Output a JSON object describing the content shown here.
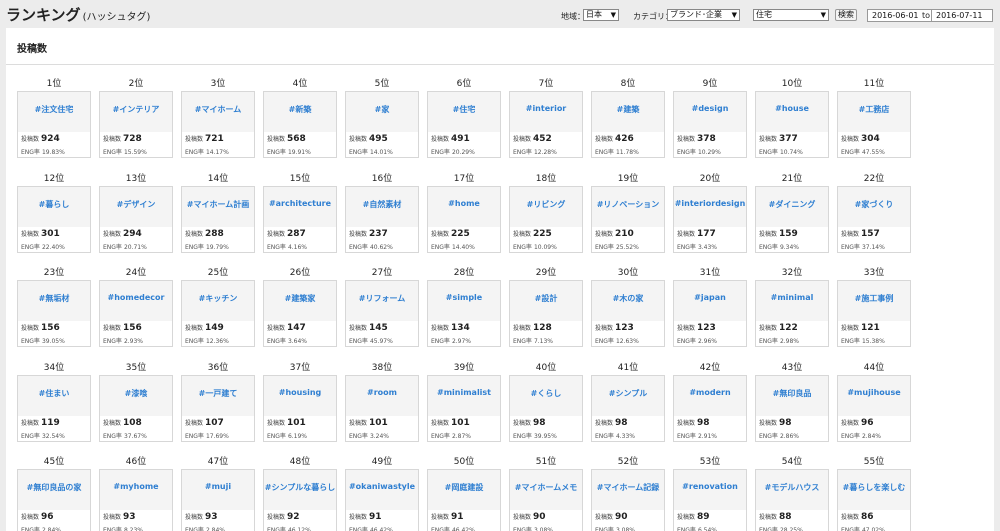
{
  "header": {
    "title": "ランキング",
    "subtitle": "(ハッシュタグ)",
    "region_label": "地域：",
    "region_value": "日本",
    "category_label": "カテゴリ：",
    "category_value": "ブランド･企業",
    "subcategory_value": "住宅",
    "search_label": "検索",
    "date_from": "2016-06-01",
    "date_sep": "to",
    "date_to": "2016-07-11"
  },
  "section": {
    "title": "投稿数"
  },
  "labels": {
    "posts": "投稿数",
    "eng": "ENG率"
  },
  "ranking": [
    {
      "rank": "1位",
      "tag": "#注文住宅",
      "posts": "924",
      "eng": "19.83%"
    },
    {
      "rank": "2位",
      "tag": "#インテリア",
      "posts": "728",
      "eng": "15.59%"
    },
    {
      "rank": "3位",
      "tag": "#マイホーム",
      "posts": "721",
      "eng": "14.17%"
    },
    {
      "rank": "4位",
      "tag": "#新築",
      "posts": "568",
      "eng": "19.91%"
    },
    {
      "rank": "5位",
      "tag": "#家",
      "posts": "495",
      "eng": "14.01%"
    },
    {
      "rank": "6位",
      "tag": "#住宅",
      "posts": "491",
      "eng": "20.29%"
    },
    {
      "rank": "7位",
      "tag": "#interior",
      "posts": "452",
      "eng": "12.28%"
    },
    {
      "rank": "8位",
      "tag": "#建築",
      "posts": "426",
      "eng": "11.78%"
    },
    {
      "rank": "9位",
      "tag": "#design",
      "posts": "378",
      "eng": "10.29%"
    },
    {
      "rank": "10位",
      "tag": "#house",
      "posts": "377",
      "eng": "10.74%"
    },
    {
      "rank": "11位",
      "tag": "#工務店",
      "posts": "304",
      "eng": "47.55%"
    },
    {
      "rank": "12位",
      "tag": "#暮らし",
      "posts": "301",
      "eng": "22.40%"
    },
    {
      "rank": "13位",
      "tag": "#デザイン",
      "posts": "294",
      "eng": "20.71%"
    },
    {
      "rank": "14位",
      "tag": "#マイホーム計画",
      "posts": "288",
      "eng": "19.79%"
    },
    {
      "rank": "15位",
      "tag": "#architecture",
      "posts": "287",
      "eng": "4.16%"
    },
    {
      "rank": "16位",
      "tag": "#自然素材",
      "posts": "237",
      "eng": "40.62%"
    },
    {
      "rank": "17位",
      "tag": "#home",
      "posts": "225",
      "eng": "14.40%"
    },
    {
      "rank": "18位",
      "tag": "#リビング",
      "posts": "225",
      "eng": "10.09%"
    },
    {
      "rank": "19位",
      "tag": "#リノベーション",
      "posts": "210",
      "eng": "25.52%"
    },
    {
      "rank": "20位",
      "tag": "#interiordesign",
      "posts": "177",
      "eng": "3.43%"
    },
    {
      "rank": "21位",
      "tag": "#ダイニング",
      "posts": "159",
      "eng": "9.34%"
    },
    {
      "rank": "22位",
      "tag": "#家づくり",
      "posts": "157",
      "eng": "37.14%"
    },
    {
      "rank": "23位",
      "tag": "#無垢材",
      "posts": "156",
      "eng": "39.05%"
    },
    {
      "rank": "24位",
      "tag": "#homedecor",
      "posts": "156",
      "eng": "2.93%"
    },
    {
      "rank": "25位",
      "tag": "#キッチン",
      "posts": "149",
      "eng": "12.36%"
    },
    {
      "rank": "26位",
      "tag": "#建築家",
      "posts": "147",
      "eng": "3.64%"
    },
    {
      "rank": "27位",
      "tag": "#リフォーム",
      "posts": "145",
      "eng": "45.97%"
    },
    {
      "rank": "28位",
      "tag": "#simple",
      "posts": "134",
      "eng": "2.97%"
    },
    {
      "rank": "29位",
      "tag": "#設計",
      "posts": "128",
      "eng": "7.13%"
    },
    {
      "rank": "30位",
      "tag": "#木の家",
      "posts": "123",
      "eng": "12.63%"
    },
    {
      "rank": "31位",
      "tag": "#japan",
      "posts": "123",
      "eng": "2.96%"
    },
    {
      "rank": "32位",
      "tag": "#minimal",
      "posts": "122",
      "eng": "2.98%"
    },
    {
      "rank": "33位",
      "tag": "#施工事例",
      "posts": "121",
      "eng": "15.38%"
    },
    {
      "rank": "34位",
      "tag": "#住まい",
      "posts": "119",
      "eng": "32.54%"
    },
    {
      "rank": "35位",
      "tag": "#漆喰",
      "posts": "108",
      "eng": "37.67%"
    },
    {
      "rank": "36位",
      "tag": "#一戸建て",
      "posts": "107",
      "eng": "17.69%"
    },
    {
      "rank": "37位",
      "tag": "#housing",
      "posts": "101",
      "eng": "6.19%"
    },
    {
      "rank": "38位",
      "tag": "#room",
      "posts": "101",
      "eng": "3.24%"
    },
    {
      "rank": "39位",
      "tag": "#minimalist",
      "posts": "101",
      "eng": "2.87%"
    },
    {
      "rank": "40位",
      "tag": "#くらし",
      "posts": "98",
      "eng": "39.95%"
    },
    {
      "rank": "41位",
      "tag": "#シンプル",
      "posts": "98",
      "eng": "4.33%"
    },
    {
      "rank": "42位",
      "tag": "#modern",
      "posts": "98",
      "eng": "2.91%"
    },
    {
      "rank": "43位",
      "tag": "#無印良品",
      "posts": "98",
      "eng": "2.86%"
    },
    {
      "rank": "44位",
      "tag": "#mujihouse",
      "posts": "96",
      "eng": "2.84%"
    },
    {
      "rank": "45位",
      "tag": "#無印良品の家",
      "posts": "96",
      "eng": "2.84%"
    },
    {
      "rank": "46位",
      "tag": "#myhome",
      "posts": "93",
      "eng": "8.23%"
    },
    {
      "rank": "47位",
      "tag": "#muji",
      "posts": "93",
      "eng": "2.84%"
    },
    {
      "rank": "48位",
      "tag": "#シンプルな暮らし",
      "posts": "92",
      "eng": "46.12%"
    },
    {
      "rank": "49位",
      "tag": "#okaniwastyle",
      "posts": "91",
      "eng": "46.42%"
    },
    {
      "rank": "50位",
      "tag": "#岡庭建設",
      "posts": "91",
      "eng": "46.42%"
    },
    {
      "rank": "51位",
      "tag": "#マイホームメモ",
      "posts": "90",
      "eng": "3.08%"
    },
    {
      "rank": "52位",
      "tag": "#マイホーム記録",
      "posts": "90",
      "eng": "3.08%"
    },
    {
      "rank": "53位",
      "tag": "#renovation",
      "posts": "89",
      "eng": "6.54%"
    },
    {
      "rank": "54位",
      "tag": "#モデルハウス",
      "posts": "88",
      "eng": "28.25%"
    },
    {
      "rank": "55位",
      "tag": "#暮らしを楽しむ",
      "posts": "86",
      "eng": "47.02%"
    }
  ]
}
